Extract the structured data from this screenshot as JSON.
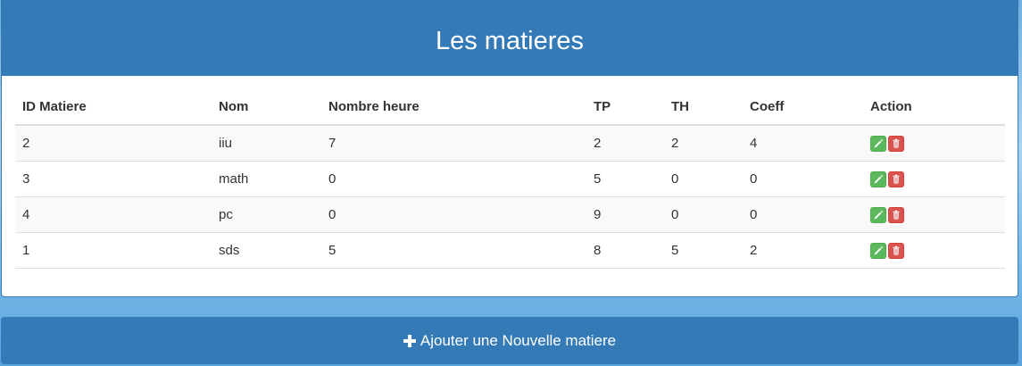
{
  "header": {
    "title": "Les matieres"
  },
  "table": {
    "columns": [
      "ID Matiere",
      "Nom",
      "Nombre heure",
      "TP",
      "TH",
      "Coeff",
      "Action"
    ],
    "rows": [
      {
        "id": "2",
        "nom": "iiu",
        "heures": "7",
        "tp": "2",
        "th": "2",
        "coeff": "4"
      },
      {
        "id": "3",
        "nom": "math",
        "heures": "0",
        "tp": "5",
        "th": "0",
        "coeff": "0"
      },
      {
        "id": "4",
        "nom": "pc",
        "heures": "0",
        "tp": "9",
        "th": "0",
        "coeff": "0"
      },
      {
        "id": "1",
        "nom": "sds",
        "heures": "5",
        "tp": "8",
        "th": "5",
        "coeff": "2"
      }
    ],
    "row_actions": [
      "pencil-icon",
      "trash-icon"
    ]
  },
  "add_button": {
    "label": "Ajouter une Nouvelle matiere",
    "icon": "plus-icon"
  },
  "colors": {
    "primary": "#337ab7",
    "edit": "#5cb85c",
    "delete": "#d9534f"
  }
}
